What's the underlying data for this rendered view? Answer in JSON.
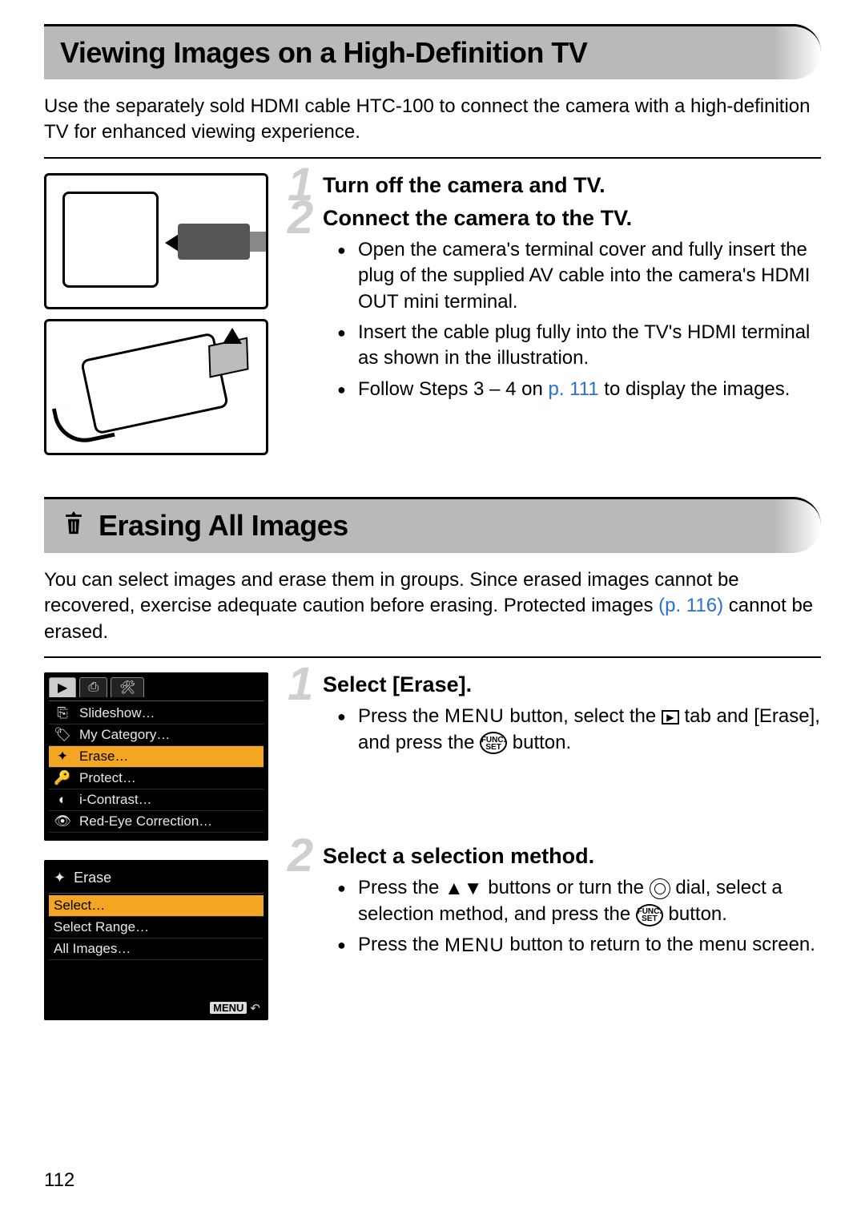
{
  "section1": {
    "title": "Viewing Images on a High-Definition TV",
    "intro": "Use the separately sold HDMI cable HTC-100 to connect the camera with a high-definition TV for enhanced viewing experience.",
    "steps": [
      {
        "num": "1",
        "title": "Turn off the camera and TV."
      },
      {
        "num": "2",
        "title": "Connect the camera to the TV.",
        "bullets": [
          {
            "text": "Open the camera's terminal cover and fully insert the plug of the supplied AV cable into the camera's HDMI OUT mini terminal."
          },
          {
            "text": "Insert the cable plug fully into the TV's HDMI terminal as shown in the illustration."
          },
          {
            "pre": "Follow Steps 3 – 4 on ",
            "link": "p. 111",
            "post": " to display the images."
          }
        ]
      }
    ]
  },
  "section2": {
    "icon": "erase-icon",
    "title": "Erasing All Images",
    "intro_pre": "You can select images and erase them in groups. Since erased images cannot be recovered, exercise adequate caution before erasing. Protected images ",
    "intro_link": "(p. 116)",
    "intro_post": " cannot be erased.",
    "lcd1": {
      "tabs": [
        "▶",
        "⎙",
        "🛠"
      ],
      "rows": [
        {
          "icon": "⎘",
          "label": "Slideshow…"
        },
        {
          "icon": "🏷",
          "label": "My Category…"
        },
        {
          "icon": "✦",
          "label": "Erase…",
          "selected": true
        },
        {
          "icon": "🔑",
          "label": "Protect…"
        },
        {
          "icon": "◐",
          "label": "i-Contrast…"
        },
        {
          "icon": "👁",
          "label": "Red-Eye Correction…"
        }
      ]
    },
    "lcd2": {
      "title_icon": "✦",
      "title": "Erase",
      "rows": [
        {
          "label": "Select…",
          "selected": true
        },
        {
          "label": "Select Range…"
        },
        {
          "label": "All Images…"
        }
      ],
      "footer_menu": "MENU",
      "footer_back": "↶"
    },
    "steps": [
      {
        "num": "1",
        "title": "Select [Erase].",
        "bullets": [
          {
            "parts": [
              "Press the ",
              {
                "glyph": "MENU"
              },
              " button, select the ",
              {
                "glyph": "PLAYTAB"
              },
              " tab and [Erase], and press the ",
              {
                "glyph": "FUNC"
              },
              " button."
            ]
          }
        ]
      },
      {
        "num": "2",
        "title": "Select a selection method.",
        "bullets": [
          {
            "parts": [
              "Press the ",
              {
                "glyph": "UPDOWN"
              },
              " buttons or turn the ",
              {
                "glyph": "DIAL"
              },
              " dial, select a selection method, and press the ",
              {
                "glyph": "FUNC"
              },
              " button."
            ]
          },
          {
            "parts": [
              "Press the ",
              {
                "glyph": "MENU"
              },
              " button to return to the menu screen."
            ]
          }
        ]
      }
    ]
  },
  "page_number": "112"
}
